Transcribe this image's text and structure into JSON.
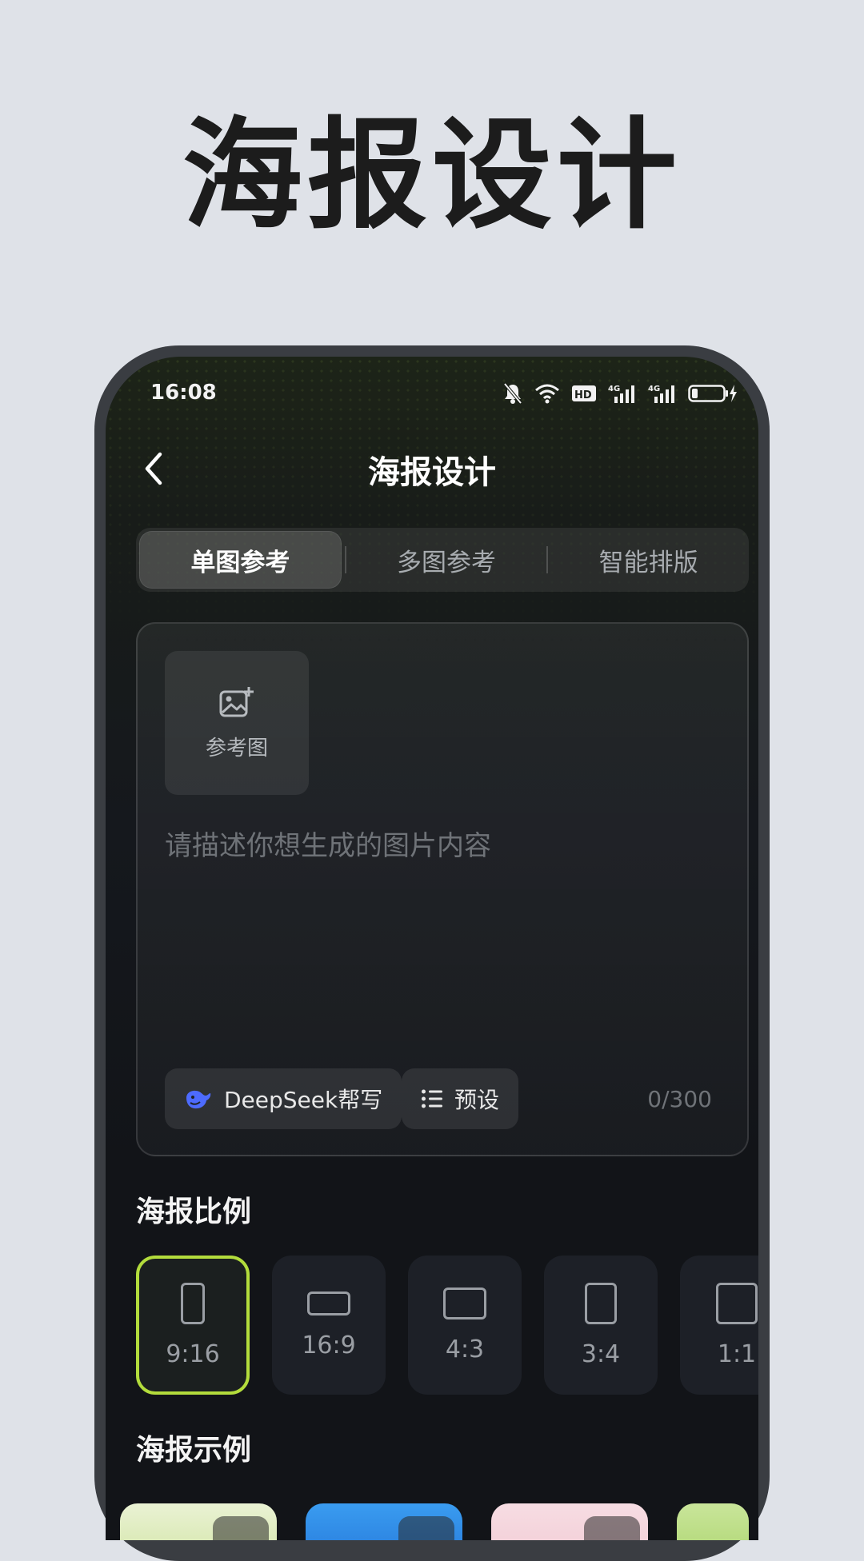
{
  "headline": "海报设计",
  "status_bar": {
    "time": "16:08"
  },
  "nav": {
    "title": "海报设计"
  },
  "tabs": [
    {
      "label": "单图参考",
      "active": true
    },
    {
      "label": "多图参考",
      "active": false
    },
    {
      "label": "智能排版",
      "active": false
    }
  ],
  "card": {
    "ref_label": "参考图",
    "prompt_placeholder": "请描述你想生成的图片内容",
    "prompt_value": "",
    "deepseek_label": "DeepSeek帮写",
    "preset_label": "预设",
    "counter": "0/300"
  },
  "ratio_section": {
    "title": "海报比例",
    "options": [
      {
        "label": "9:16",
        "selected": true
      },
      {
        "label": "16:9",
        "selected": false
      },
      {
        "label": "4:3",
        "selected": false
      },
      {
        "label": "3:4",
        "selected": false
      },
      {
        "label": "1:1",
        "selected": false
      }
    ]
  },
  "examples_section": {
    "title": "海报示例"
  },
  "colors": {
    "accent": "#b3dc3c",
    "deepseek_blue": "#4d6bfe"
  }
}
